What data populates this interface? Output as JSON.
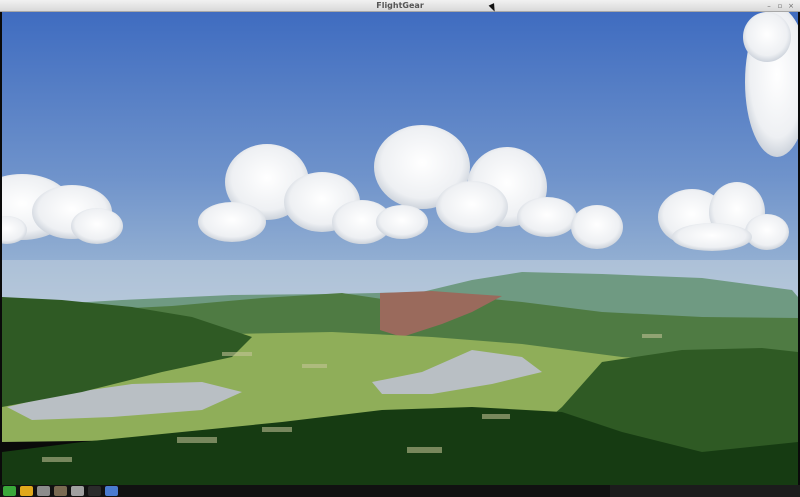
{
  "window": {
    "title": "FlightGear",
    "controls": {
      "minimize": "–",
      "maximize": "▫",
      "close": "×"
    }
  },
  "scene": {
    "sky_top": "#3f6cc0",
    "sky_horizon": "#a7bfd6",
    "haze": "#c2d0dc",
    "ridge_far": "#6f9a82",
    "hill_mid": "#4f7b43",
    "hill_near": "#2f5a24",
    "forest_dark": "#163b12",
    "field_light": "#8fae59",
    "bare_slope": "#9a6a5c",
    "town": "#b9bfc4"
  },
  "taskbar": {
    "icons": [
      "app-icon-green",
      "app-icon-yellow",
      "app-icon-photo",
      "app-icon-files",
      "app-icon-folder",
      "app-icon-terminal",
      "app-icon-window"
    ],
    "colors": [
      "#3aa83a",
      "#e0a81c",
      "#8c8c8c",
      "#7a6a52",
      "#a0a0a0",
      "#2b2b2b",
      "#4a7bd0"
    ]
  }
}
